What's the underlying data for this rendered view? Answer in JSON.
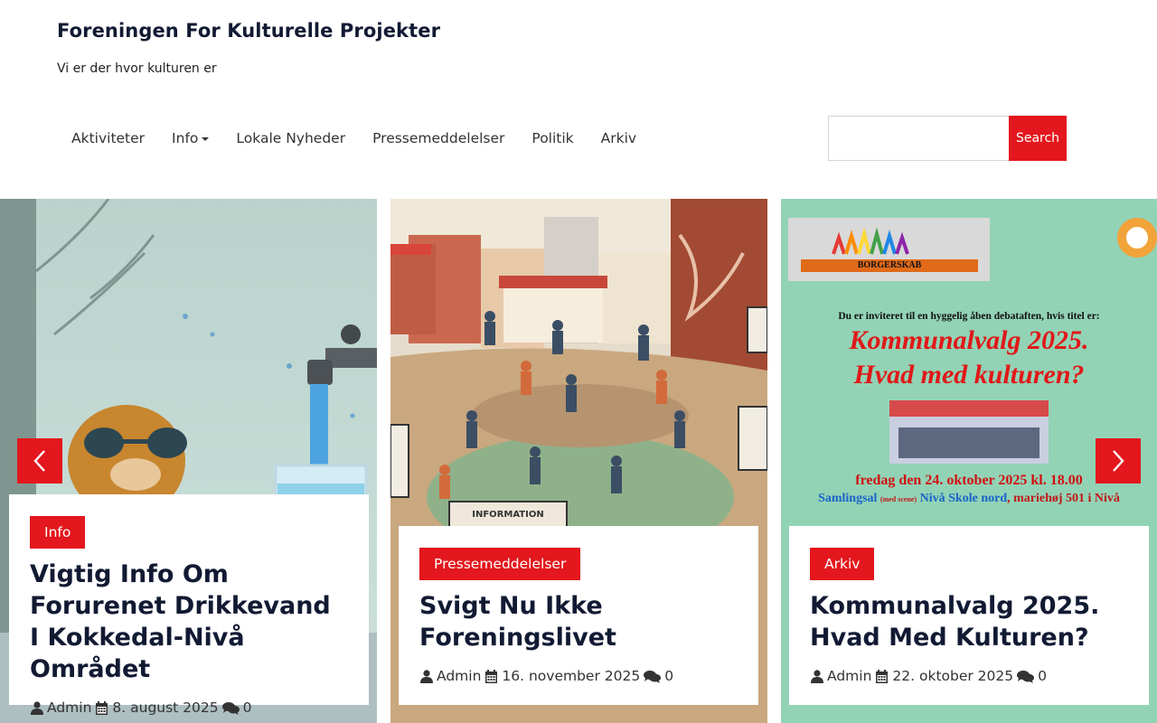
{
  "site": {
    "title": "Foreningen For Kulturelle Projekter",
    "tagline": "Vi er der hvor kulturen er"
  },
  "nav": {
    "items": [
      "Aktiviteter",
      "Info",
      "Lokale Nyheder",
      "Pressemeddelelser",
      "Politik",
      "Arkiv"
    ]
  },
  "search": {
    "value": "",
    "placeholder": "",
    "button_label": "Search"
  },
  "slides": [
    {
      "category": "Info",
      "title": "Vigtig Info Om Forurenet Drikkevand I Kokkedal-Nivå Området",
      "author": "Admin",
      "date": "8. august 2025",
      "comments": "0"
    },
    {
      "category": "Pressemeddelelser",
      "title": "Svigt Nu Ikke Foreningslivet",
      "author": "Admin",
      "date": "16. november 2025",
      "comments": "0",
      "image_label": "INFORMATION"
    },
    {
      "category": "Arkiv",
      "title": "Kommunalvalg 2025. Hvad Med Kulturen?",
      "author": "Admin",
      "date": "22. oktober 2025",
      "comments": "0",
      "poster": {
        "logo_text": "BORGERSKAB",
        "intro": "Du er inviteret til en hyggelig åben debataften, hvis titel er:",
        "headline_1": "Kommunalvalg 2025.",
        "headline_2": "Hvad med kulturen?",
        "datetime": "fredag den 24. oktober 2025 kl. 18.00",
        "venue_a": "Samlingsal",
        "venue_small": "(med scene)",
        "venue_b": "Nivå Skole nord",
        "venue_c": ", mariehøj 501 i Nivå"
      }
    }
  ],
  "colors": {
    "accent": "#e3171d",
    "title": "#121a33"
  },
  "icons": {
    "author": "user-icon",
    "date": "calendar-icon",
    "comments": "comments-icon",
    "prev": "chevron-left-icon",
    "next": "chevron-right-icon"
  }
}
